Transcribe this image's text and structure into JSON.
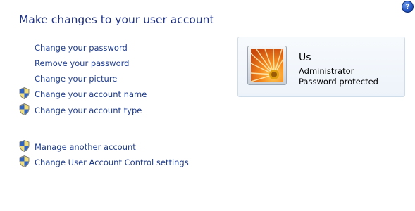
{
  "page": {
    "title": "Make changes to your user account"
  },
  "help": {
    "label": "?"
  },
  "tasks": {
    "change_password": "Change your password",
    "remove_password": "Remove your password",
    "change_picture": "Change your picture",
    "change_account_name": "Change your account name",
    "change_account_type": "Change your account type",
    "manage_another_account": "Manage another account",
    "change_uac_settings": "Change User Account Control settings"
  },
  "account": {
    "name": "Us",
    "type": "Administrator",
    "password_status": "Password protected",
    "picture": "flower-icon"
  },
  "icons": {
    "shield": "uac-shield-icon",
    "help": "help-icon"
  },
  "colors": {
    "title": "#1e3287",
    "link": "#1e3c8c",
    "card_border": "#cfdcea"
  }
}
